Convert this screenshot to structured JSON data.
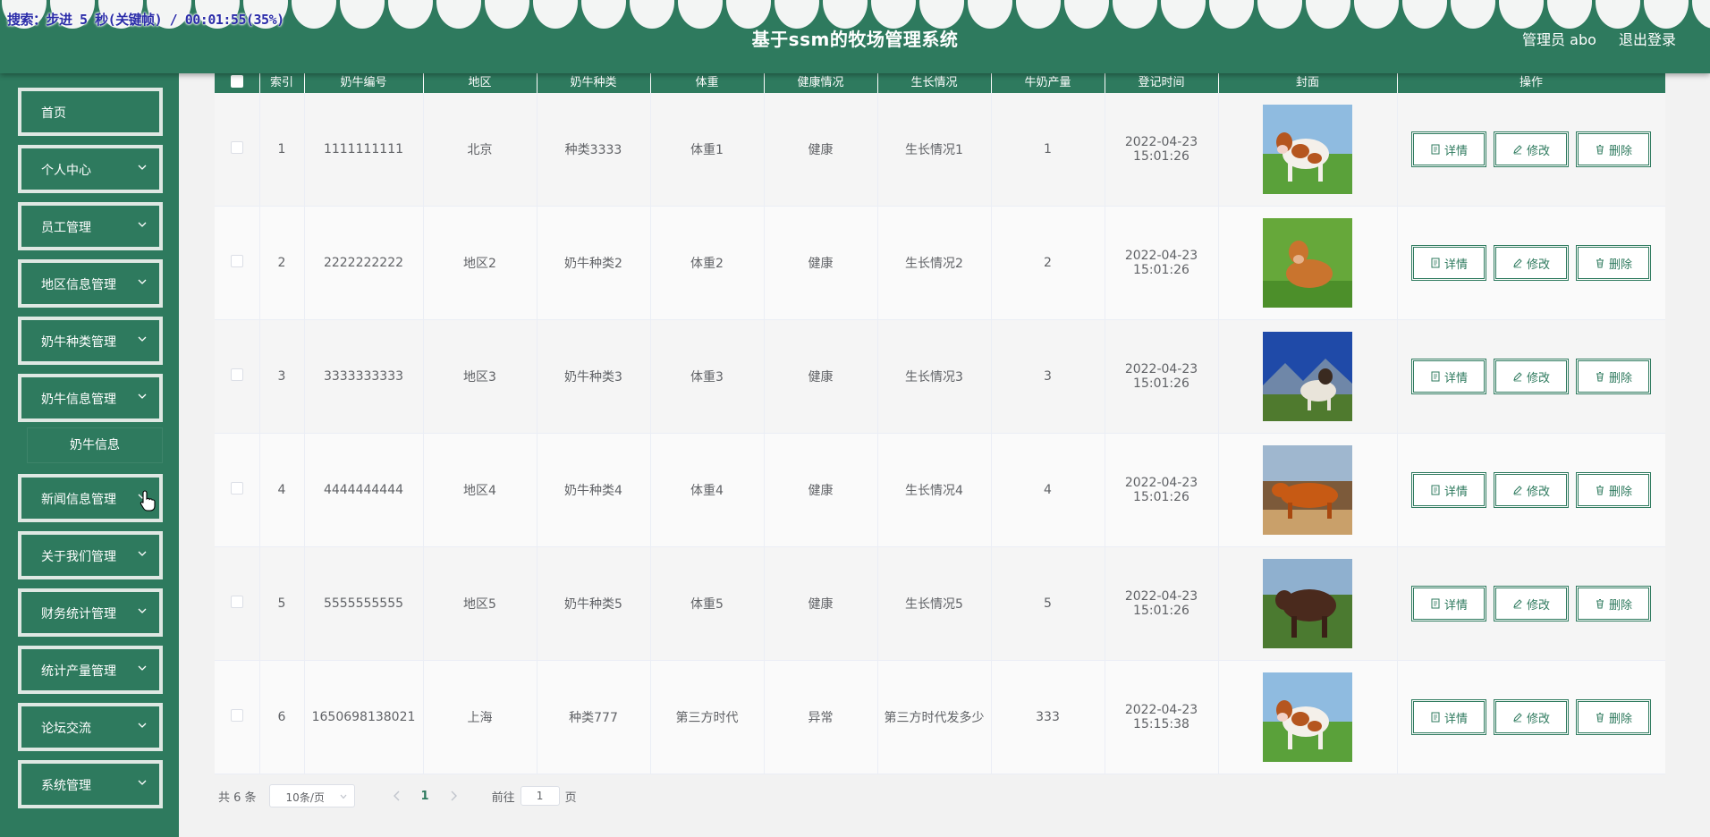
{
  "overlay": {
    "text": "搜索：步进 5 秒(关键帧) / 00:01:55(35%)"
  },
  "header": {
    "title": "基于ssm的牧场管理系统",
    "user_label": "管理员 abo",
    "logout_label": "退出登录"
  },
  "sidebar": {
    "items": [
      {
        "label": "首页",
        "chevron": false
      },
      {
        "label": "个人中心",
        "chevron": true
      },
      {
        "label": "员工管理",
        "chevron": true
      },
      {
        "label": "地区信息管理",
        "chevron": true
      },
      {
        "label": "奶牛种类管理",
        "chevron": true
      },
      {
        "label": "奶牛信息管理",
        "chevron": true
      },
      {
        "label": "新闻信息管理",
        "chevron": true
      },
      {
        "label": "关于我们管理",
        "chevron": true
      },
      {
        "label": "财务统计管理",
        "chevron": true
      },
      {
        "label": "统计产量管理",
        "chevron": true
      },
      {
        "label": "论坛交流",
        "chevron": true
      },
      {
        "label": "系统管理",
        "chevron": true
      }
    ],
    "submenu": {
      "label": "奶牛信息"
    }
  },
  "table": {
    "headers": [
      "索引",
      "奶牛编号",
      "地区",
      "奶牛种类",
      "体重",
      "健康情况",
      "生长情况",
      "牛奶产量",
      "登记时间",
      "封面",
      "操作"
    ],
    "rows": [
      {
        "index": "1",
        "code": "1111111111",
        "region": "北京",
        "type": "种类3333",
        "weight": "体重1",
        "health": "健康",
        "growth": "生长情况1",
        "yield": "1",
        "time": "2022-04-23 15:01:26",
        "cover": "cow-white-brown-spots"
      },
      {
        "index": "2",
        "code": "2222222222",
        "region": "地区2",
        "type": "奶牛种类2",
        "weight": "体重2",
        "health": "健康",
        "growth": "生长情况2",
        "yield": "2",
        "time": "2022-04-23 15:01:26",
        "cover": "cow-orange-lying"
      },
      {
        "index": "3",
        "code": "3333333333",
        "region": "地区3",
        "type": "奶牛种类3",
        "weight": "体重3",
        "health": "健康",
        "growth": "生长情况3",
        "yield": "3",
        "time": "2022-04-23 15:01:26",
        "cover": "cow-mountain-sky"
      },
      {
        "index": "4",
        "code": "4444444444",
        "region": "地区4",
        "type": "奶牛种类4",
        "weight": "体重4",
        "health": "健康",
        "growth": "生长情况4",
        "yield": "4",
        "time": "2022-04-23 15:01:26",
        "cover": "cow-orange-standing"
      },
      {
        "index": "5",
        "code": "5555555555",
        "region": "地区5",
        "type": "奶牛种类5",
        "weight": "体重5",
        "health": "健康",
        "growth": "生长情况5",
        "yield": "5",
        "time": "2022-04-23 15:01:26",
        "cover": "cow-dark-brown"
      },
      {
        "index": "6",
        "code": "1650698138021",
        "region": "上海",
        "type": "种类777",
        "weight": "第三方时代",
        "health": "异常",
        "growth": "第三方时代发多少",
        "yield": "333",
        "time": "2022-04-23 15:15:38",
        "cover": "cow-white-brown-spots"
      }
    ],
    "actions": {
      "detail": "详情",
      "edit": "修改",
      "delete": "删除"
    }
  },
  "pagination": {
    "total_text": "共 6 条",
    "page_size": "10条/页",
    "current_page": "1",
    "goto_prefix": "前往",
    "goto_value": "1",
    "goto_suffix": "页"
  },
  "colors": {
    "primary": "#2e7a5e",
    "border": "#dfe8e3",
    "background": "#f2f2f2"
  }
}
